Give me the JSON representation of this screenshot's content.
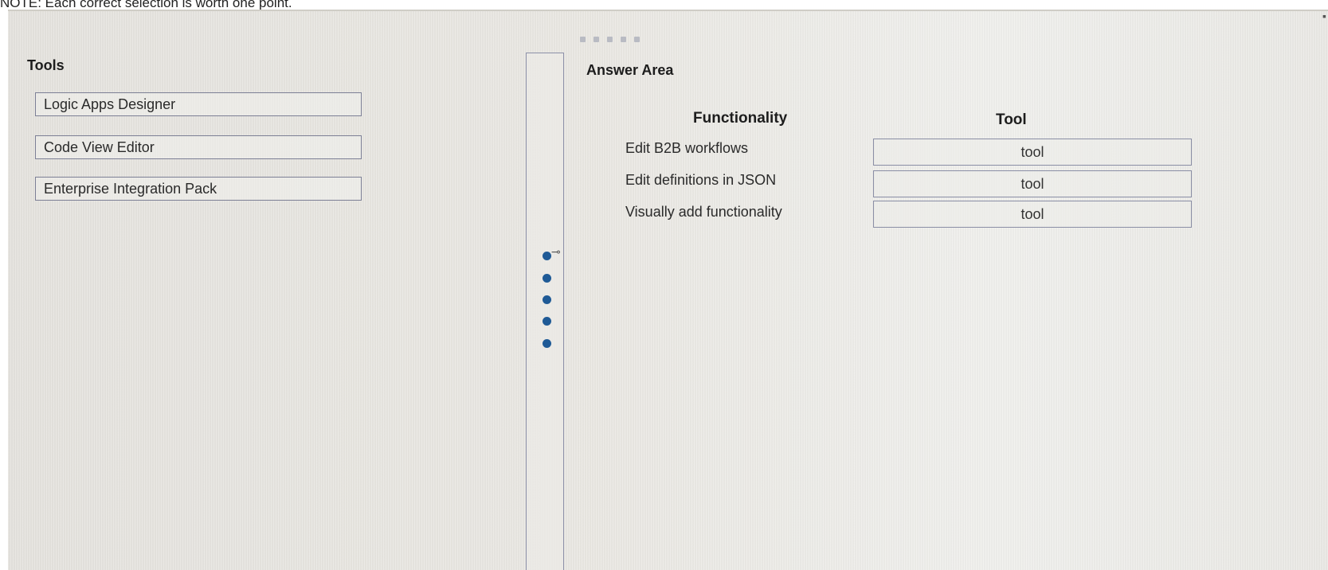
{
  "instruction_note": "NOTE: Each correct selection is worth one point.",
  "tools_panel": {
    "heading": "Tools",
    "items": [
      {
        "label": "Logic Apps Designer"
      },
      {
        "label": "Code View Editor"
      },
      {
        "label": "Enterprise Integration Pack"
      }
    ]
  },
  "answer_area": {
    "heading": "Answer Area",
    "columns": {
      "functionality": "Functionality",
      "tool": "Tool"
    },
    "rows": [
      {
        "functionality": "Edit B2B workflows",
        "tool": "tool"
      },
      {
        "functionality": "Edit definitions in JSON",
        "tool": "tool"
      },
      {
        "functionality": "Visually add functionality",
        "tool": "tool"
      }
    ]
  },
  "colors": {
    "panel_background": "#e9e7e2",
    "box_border": "#7c7f95",
    "handle_dot": "#1f5a96"
  },
  "icons": [
    "drag-handle-dots-icon",
    "top-dots-icon",
    "grip-icon"
  ]
}
